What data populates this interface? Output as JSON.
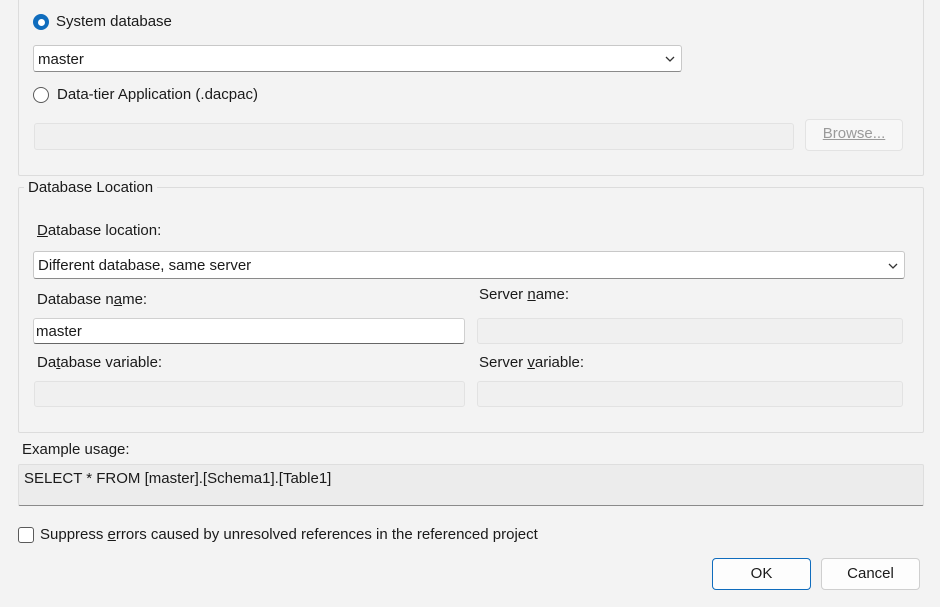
{
  "source_group": {
    "system_database_label": "System database",
    "system_database_value": "master",
    "dacpac_label": "Data-tier Application (.dacpac)",
    "dacpac_path_value": "",
    "browse_label": "Browse..."
  },
  "location_group": {
    "title": "Database Location",
    "location_label_prefix": "",
    "location_label_u": "D",
    "location_label_rest": "atabase location:",
    "location_value": "Different database, same server",
    "db_name_label_prefix": "Database n",
    "db_name_label_u": "a",
    "db_name_label_rest": "me:",
    "db_name_value": "master",
    "server_name_label_prefix": "Server ",
    "server_name_label_u": "n",
    "server_name_label_rest": "ame:",
    "server_name_value": "",
    "db_var_label_prefix": "Da",
    "db_var_label_u": "t",
    "db_var_label_rest": "abase variable:",
    "db_var_value": "",
    "server_var_label_prefix": "Server ",
    "server_var_label_u": "v",
    "server_var_label_rest": "ariable:",
    "server_var_value": ""
  },
  "example": {
    "label": "Example usage:",
    "code": "SELECT * FROM [master].[Schema1].[Table1]"
  },
  "suppress": {
    "label_prefix": "Suppress ",
    "label_u": "e",
    "label_rest": "rrors caused by unresolved references in the referenced project",
    "checked": false
  },
  "buttons": {
    "ok": "OK",
    "cancel": "Cancel"
  },
  "colors": {
    "accent": "#0f6cbd",
    "background": "#f3f3f3"
  }
}
